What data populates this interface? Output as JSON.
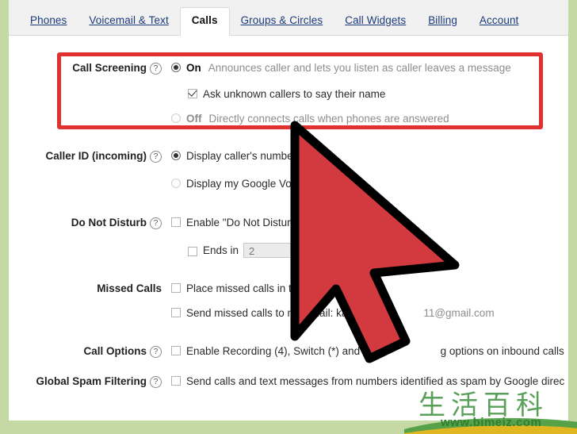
{
  "tabs": [
    {
      "label": "Phones",
      "active": false
    },
    {
      "label": "Voicemail & Text",
      "active": false
    },
    {
      "label": "Calls",
      "active": true
    },
    {
      "label": "Groups & Circles",
      "active": false
    },
    {
      "label": "Call Widgets",
      "active": false
    },
    {
      "label": "Billing",
      "active": false
    },
    {
      "label": "Account",
      "active": false
    }
  ],
  "help_glyph": "?",
  "settings": {
    "call_screening": {
      "label": "Call Screening",
      "on_label": "On",
      "on_desc": "Announces caller and lets you listen as caller leaves a message",
      "ask_name_label": "Ask unknown callers to say their name",
      "off_label": "Off",
      "off_desc": "Directly connects calls when phones are answered"
    },
    "caller_id": {
      "label": "Caller ID (incoming)",
      "option1": "Display caller's number",
      "option2": "Display my Google Voice number"
    },
    "do_not_disturb": {
      "label": "Do Not Disturb",
      "enable_label": "Enable \"Do Not Disturb\"",
      "ends_in_label": "Ends in",
      "ends_in_value": "2"
    },
    "missed_calls": {
      "label": "Missed Calls",
      "option1": "Place missed calls in the inbox",
      "option2_prefix": "Send missed calls to my email: ka",
      "option2_suffix": "11@gmail.com"
    },
    "call_options": {
      "label": "Call Options",
      "option1_prefix": "Enable Recording (4), Switch (*) and C",
      "option1_suffix": "g options on inbound calls"
    },
    "global_spam": {
      "label": "Global Spam Filtering",
      "option1": "Send calls and text messages from numbers identified as spam by Google direc"
    }
  },
  "watermark": {
    "cn_text": "生活百科",
    "url": "www.bimeiz.com"
  },
  "colors": {
    "frame_green": "#c5d9a5",
    "highlight_red": "#e03030",
    "cursor_red": "#d33a40",
    "tab_link": "#1a3a7a"
  }
}
